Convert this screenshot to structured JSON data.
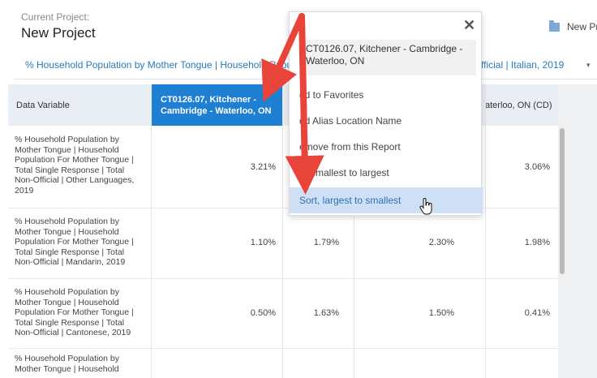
{
  "header": {
    "project_label": "Current Project:",
    "project_name": "New Project",
    "new_project_label": "New Pr"
  },
  "selector": {
    "text": "% Household Population by Mother Tongue | Household Popul",
    "tail": "fficial | Italian, 2019",
    "caret": "▾",
    "s": "s"
  },
  "table": {
    "headers": {
      "variable": "Data Variable",
      "selected": "CT0126.07, Kitchener - Cambridge - Waterloo, ON",
      "col4": "aterloo, ON (CD)"
    },
    "rows": [
      {
        "variable": "% Household Population by Mother Tongue | Household Population For Mother Tongue | Total Single Response | Total Non-Official | Other Languages, 2019",
        "c1": "3.21%",
        "c2": "",
        "c3": "",
        "c4": "3.06%"
      },
      {
        "variable": "% Household Population by Mother Tongue | Household Population For Mother Tongue | Total Single Response | Total Non-Official | Mandarin, 2019",
        "c1": "1.10%",
        "c2": "1.79%",
        "c3": "2.30%",
        "c4": "1.98%"
      },
      {
        "variable": "% Household Population by Mother Tongue | Household Population For Mother Tongue | Total Single Response | Total Non-Official | Cantonese, 2019",
        "c1": "0.50%",
        "c2": "1.63%",
        "c3": "1.50%",
        "c4": "0.41%"
      },
      {
        "variable": "% Household Population by Mother Tongue | Household",
        "c1": "",
        "c2": "",
        "c3": "",
        "c4": ""
      }
    ]
  },
  "menu": {
    "title": "CT0126.07, Kitchener - Cambridge - Waterloo, ON",
    "close": "✕",
    "items": [
      "dd to Favorites",
      "dd Alias Location Name",
      "emove from this Report",
      "rt, smallest to largest",
      "Sort, largest to smallest"
    ]
  },
  "colors": {
    "accent": "#1e7fd3",
    "link": "#2a7ab8",
    "arrow": "#e8443a",
    "highlight": "#cfe0f4"
  }
}
